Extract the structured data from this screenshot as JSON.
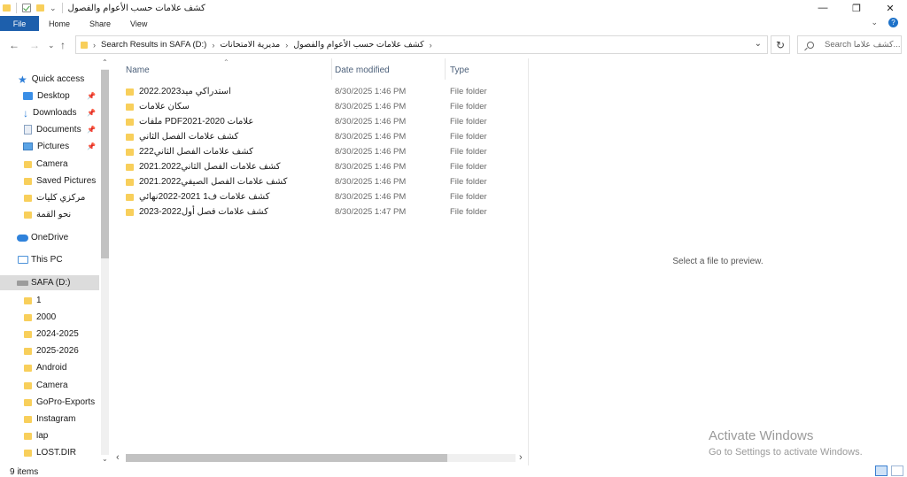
{
  "window": {
    "title": "كشف علامات حسب الأعوام والفصول",
    "controls": {
      "minimize": "—",
      "maximize": "❐",
      "close": "✕"
    }
  },
  "ribbon": {
    "tabs": [
      "File",
      "Home",
      "Share",
      "View"
    ],
    "expand_glyph": "⌄",
    "help_glyph": "?"
  },
  "navigation": {
    "back": "←",
    "forward": "→",
    "recent": "⌄",
    "up": "↑",
    "breadcrumbs": [
      "Search Results in SAFA (D:)",
      "مديرية الامتحانات",
      "كشف علامات حسب الأعوام والفصول"
    ],
    "crumb_separator": "›",
    "dropdown_glyph": "⌄",
    "refresh_glyph": "↻",
    "search_placeholder": "Search كشف علاما..."
  },
  "sidebar": {
    "quick_access_label": "Quick access",
    "items": [
      {
        "label": "Desktop",
        "icon": "desktop-icon",
        "pinned": true
      },
      {
        "label": "Downloads",
        "icon": "download-icon",
        "pinned": true
      },
      {
        "label": "Documents",
        "icon": "document-icon",
        "pinned": true
      },
      {
        "label": "Pictures",
        "icon": "pictures-icon",
        "pinned": true
      },
      {
        "label": "Camera",
        "icon": "folder-icon",
        "pinned": false
      },
      {
        "label": "Saved Pictures",
        "icon": "folder-icon",
        "pinned": false
      },
      {
        "label": "مركزي كليات",
        "icon": "folder-icon",
        "pinned": false
      },
      {
        "label": "نحو القمة",
        "icon": "folder-icon",
        "pinned": false
      }
    ],
    "onedrive_label": "OneDrive",
    "thispc_label": "This PC",
    "drive_label": "SAFA (D:)",
    "drive_folders": [
      "1",
      "2000",
      "2024-2025",
      "2025-2026",
      "Android",
      "Camera",
      "GoPro-Exports",
      "Instagram",
      "lap",
      "LOST.DIR"
    ],
    "pin_glyph": "📌"
  },
  "file_list": {
    "columns": {
      "name": "Name",
      "date": "Date modified",
      "type": "Type"
    },
    "sort_glyph": "⌃",
    "rows": [
      {
        "name": "استدراكي ميد2022.2023",
        "date": "8/30/2025 1:46 PM",
        "type": "File folder"
      },
      {
        "name": "سكان علامات",
        "date": "8/30/2025 1:46 PM",
        "type": "File folder"
      },
      {
        "name": "ملفات PDFعلامات 2020-2021",
        "date": "8/30/2025 1:46 PM",
        "type": "File folder"
      },
      {
        "name": "كشف علامات الفصل الثاني",
        "date": "8/30/2025 1:46 PM",
        "type": "File folder"
      },
      {
        "name": "كشف علامات الفصل الثاني222",
        "date": "8/30/2025 1:46 PM",
        "type": "File folder"
      },
      {
        "name": "كشف علامات الفصل الثاني2021.2022",
        "date": "8/30/2025 1:46 PM",
        "type": "File folder"
      },
      {
        "name": "كشف علامات الفصل الصيفي2021.2022",
        "date": "8/30/2025 1:46 PM",
        "type": "File folder"
      },
      {
        "name": "كشف علامات ف1 2021-2022نهائي",
        "date": "8/30/2025 1:46 PM",
        "type": "File folder"
      },
      {
        "name": "كشف علامات فصل أول2022-2023",
        "date": "8/30/2025 1:47 PM",
        "type": "File folder"
      }
    ]
  },
  "preview": {
    "message": "Select a file to preview."
  },
  "watermark": {
    "title": "Activate Windows",
    "subtitle": "Go to Settings to activate Windows."
  },
  "status": {
    "item_count": "9 items"
  },
  "scroll": {
    "up": "⌃",
    "down": "⌄",
    "left": "‹",
    "right": "›"
  }
}
